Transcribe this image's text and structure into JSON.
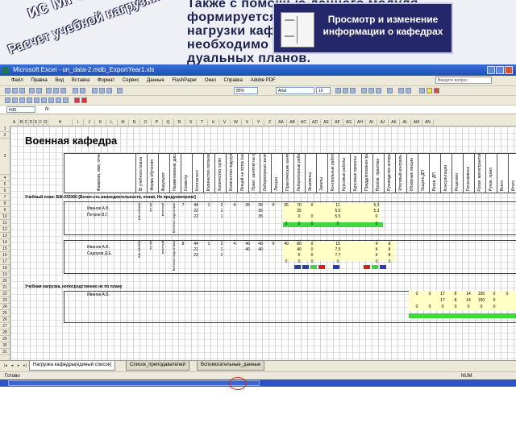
{
  "slide": {
    "text_lines": [
      "Также с помощью данного модуля",
      "формируется документ учебной",
      "нагрузки кафедры, на основе которой",
      "необходимо формировать индиви-",
      "дуальных планов."
    ],
    "stamp_primary": "ис МГОУ",
    "stamp_secondary": "Расчет учебной нагрузки",
    "callout": "Просмотр и изменение информации о кафедрах"
  },
  "window": {
    "title": "Microsoft Excel - un_data-2.mdb_ExportYear1.xls"
  },
  "menu": {
    "items": [
      "Файл",
      "Правка",
      "Вид",
      "Вставка",
      "Формат",
      "Сервис",
      "Данные",
      "FlashPaper",
      "Окно",
      "Справка",
      "Adobe PDF"
    ],
    "help_placeholder": "Введите вопрос"
  },
  "toolbar": {
    "zoom": "85%",
    "font": "Arial",
    "font_size": "10"
  },
  "formula": {
    "cell_ref": "H30",
    "fx": "fx"
  },
  "grid": {
    "columns": [
      "A",
      "B",
      "C",
      "D",
      "E",
      "F",
      "G",
      "H",
      "I",
      "J",
      "K",
      "L",
      "M",
      "N",
      "O",
      "P",
      "Q",
      "R",
      "S",
      "T",
      "U",
      "V",
      "W",
      "X",
      "Y",
      "Z",
      "AA",
      "AB",
      "AC",
      "AD",
      "AE",
      "AF",
      "AG",
      "AH",
      "AI",
      "AJ",
      "AK",
      "AL",
      "AM",
      "AN"
    ],
    "rows": [
      "1",
      "2",
      "3",
      "4",
      "5",
      "6",
      "7",
      "8",
      "9",
      "10",
      "11",
      "12",
      "13",
      "14",
      "15",
      "16",
      "17",
      "18",
      "19",
      "20",
      "21",
      "22",
      "23",
      "24",
      "25",
      "26",
      "27",
      "28",
      "29",
      "30",
      "31"
    ],
    "sheet_title": "Военная кафедра",
    "headers": [
      "Фамилия, имя, отчество",
      "ID учебного плана",
      "Форма обучения",
      "Факультет",
      "Наименование дисциплины",
      "Семестр",
      "Контингент",
      "Количество потоков",
      "Количество групп",
      "Количество подгрупп",
      "Лекций на поток (нагрузка)",
      "Практ. занятий на группу",
      "Лабораторных занятий на подгруппу",
      "Лекции",
      "Практические занятия",
      "Лабораторные работы",
      "Экзамены",
      "Зачеты",
      "Контрольные работы",
      "Курсовые работы",
      "Курсовые проекты",
      "Преддипломная практика",
      "Произв. практика",
      "Руководство аспирантами",
      "Итоговый контроль",
      "Обзорные лекции",
      "Защита ДП",
      "Руков. ДП",
      "Консультации",
      "Рецензии",
      "Госэкзамены",
      "Руков. магистрантами",
      "Руков. практ.",
      "Всего",
      "Итого"
    ],
    "section1": "Учебный план: БЖ-033300 [Безоп-сть жизнедеятельности, очная, Не предусмотрено]",
    "section1_code": "БЖ-033300",
    "section1_names": [
      "Иванов А.Б.",
      "Петров В.Г."
    ],
    "section1_form": "очная",
    "section1_dept": "военный",
    "section1_disc": "Военная подготовка",
    "section1_rows": [
      [
        "7",
        "44",
        "1",
        "2",
        "4",
        "35",
        "35",
        "0",
        "35",
        "70",
        "0",
        "",
        "11",
        "",
        "",
        "5.3"
      ],
      [
        "",
        "22",
        "",
        "1",
        "",
        "",
        "35",
        "",
        "",
        "35",
        "",
        "",
        "5.5",
        "",
        "",
        "5.3"
      ],
      [
        "",
        "22",
        "",
        "1",
        "",
        "",
        "35",
        "",
        "",
        "0",
        "0",
        "",
        "5.5",
        "",
        "",
        "0"
      ],
      [
        "",
        "",
        "",
        "",
        "",
        "",
        "",
        "",
        "0",
        "0",
        "0",
        "",
        "0",
        "",
        "",
        "0"
      ]
    ],
    "section2_names": [
      "Иванов А.Б.",
      "Сидоров Д.Е."
    ],
    "section2_rows": [
      [
        "8",
        "44",
        "1",
        "2",
        "4",
        "40",
        "40",
        "0",
        "40",
        "80",
        "0",
        "",
        "15",
        "",
        "",
        "4",
        "8"
      ],
      [
        "",
        "21",
        "",
        "1",
        "",
        "40",
        "40",
        "",
        "",
        "40",
        "0",
        "",
        "7.5",
        "",
        "",
        "4",
        "8"
      ],
      [
        "",
        "23",
        "",
        "2",
        "",
        "",
        "",
        "",
        "",
        "0",
        "0",
        "",
        "7.7",
        "",
        "",
        "4",
        "8"
      ],
      [
        "",
        "",
        "",
        "",
        "",
        "",
        "",
        "",
        "0",
        "0",
        "0",
        "",
        "0",
        "",
        "",
        "0",
        "0"
      ]
    ],
    "section3": "Учебная нагрузка, непосредственно не по плану",
    "section3_name": "Иванов А.Б.",
    "section3_rows": [
      [
        "0",
        "0",
        "17",
        "8",
        "14",
        "150",
        "0",
        "0",
        "7"
      ],
      [
        "",
        "",
        "17",
        "8",
        "14",
        "150",
        "0",
        "",
        "7"
      ],
      [
        "0",
        "0",
        "0",
        "0",
        "0",
        "0",
        "0",
        "",
        "0"
      ]
    ]
  },
  "tabs": {
    "items": [
      "Нагрузка кафедры(единый список)",
      "Список_преподавателей",
      "Вспомогательные_данные"
    ],
    "active_index": 0
  },
  "status": {
    "ready": "Готово",
    "num": "NUM"
  }
}
